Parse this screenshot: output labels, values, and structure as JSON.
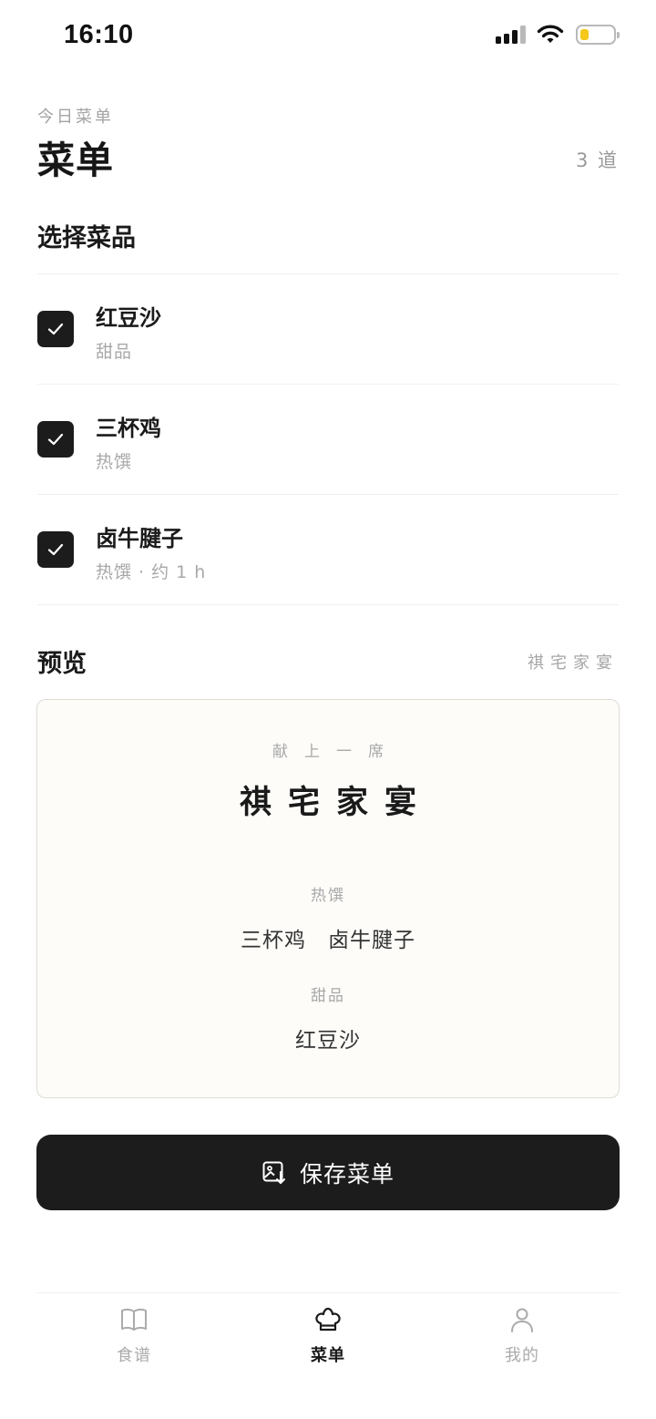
{
  "status_bar": {
    "time": "16:10"
  },
  "header": {
    "subtitle": "今日菜单",
    "title": "菜单",
    "count": "3 道"
  },
  "select_section": {
    "title": "选择菜品",
    "dishes": [
      {
        "name": "红豆沙",
        "meta": "甜品",
        "checked": true
      },
      {
        "name": "三杯鸡",
        "meta": "热馔",
        "checked": true
      },
      {
        "name": "卤牛腱子",
        "meta": "热馔 · 约 1 h",
        "checked": true
      }
    ]
  },
  "preview": {
    "title": "预览",
    "style_name": "祺宅家宴",
    "card": {
      "kicker": "献上一席",
      "title": "祺宅家宴",
      "groups": [
        {
          "category": "热馔",
          "items": [
            "三杯鸡",
            "卤牛腱子"
          ]
        },
        {
          "category": "甜品",
          "items": [
            "红豆沙"
          ]
        }
      ]
    }
  },
  "save_button": {
    "label": "保存菜单",
    "icon": "image-download-icon"
  },
  "tab_bar": {
    "tabs": [
      {
        "label": "食谱",
        "icon": "book-icon",
        "active": false
      },
      {
        "label": "菜单",
        "icon": "chef-hat-icon",
        "active": true
      },
      {
        "label": "我的",
        "icon": "person-icon",
        "active": false
      }
    ]
  },
  "colors": {
    "primary": "#1c1c1c",
    "muted": "#a8a8a8",
    "card_bg": "#fdfcf9",
    "battery": "#f5c81b"
  }
}
